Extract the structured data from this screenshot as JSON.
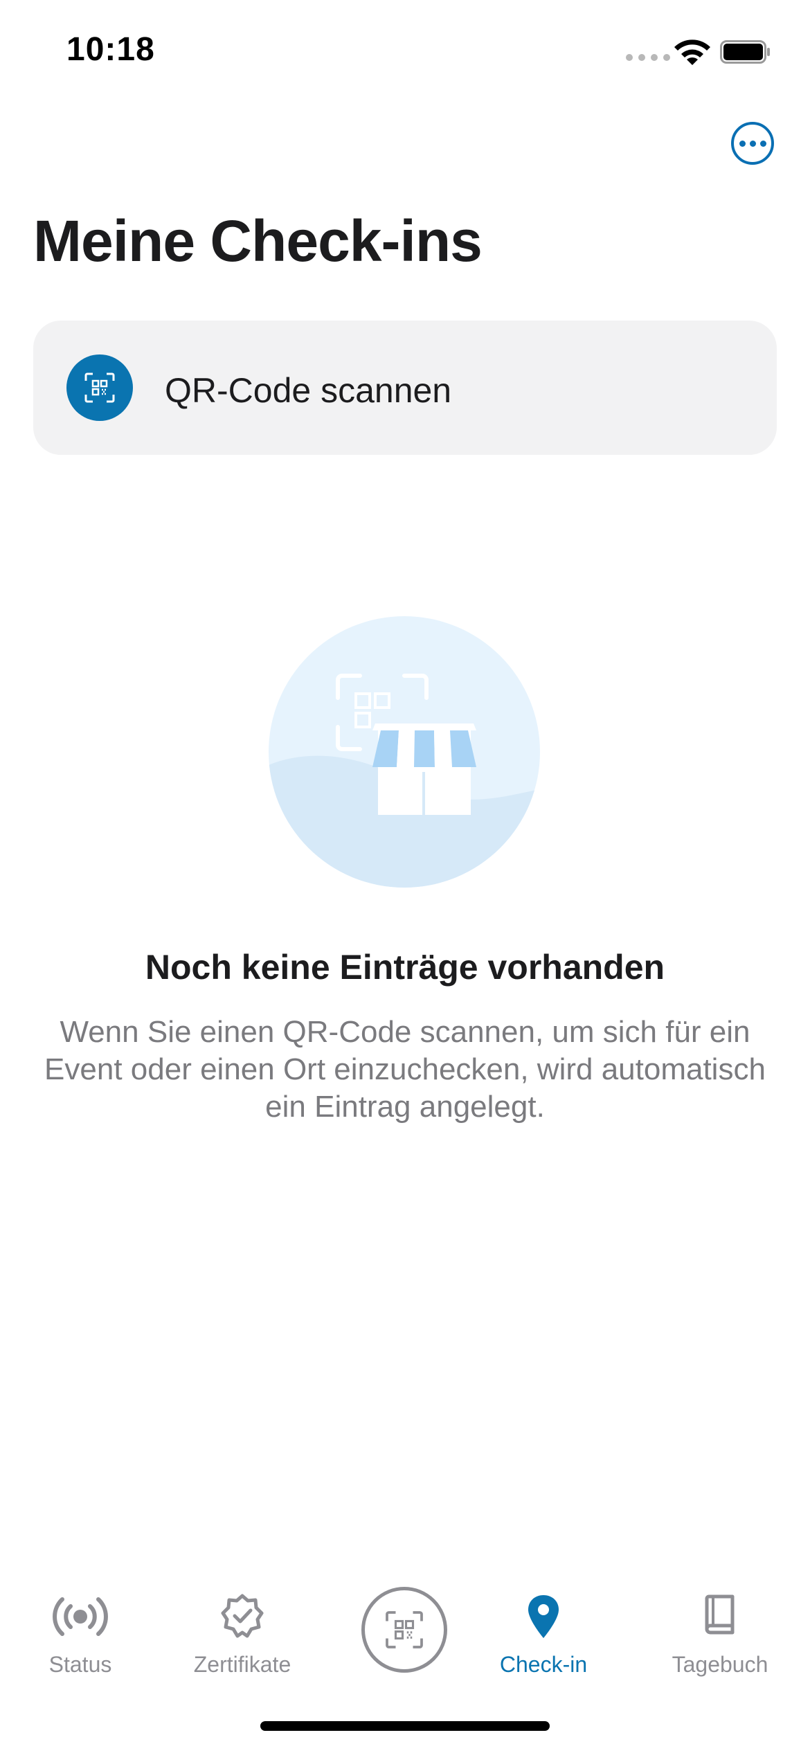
{
  "status_bar": {
    "time": "10:18"
  },
  "header": {
    "title": "Meine Check-ins"
  },
  "scan_card": {
    "label": "QR-Code scannen"
  },
  "empty_state": {
    "title": "Noch keine Einträge vorhanden",
    "description": "Wenn Sie einen QR-Code scannen, um sich für ein Event oder einen Ort einzuchecken, wird automatisch ein Eintrag angelegt."
  },
  "tab_bar": {
    "tabs": [
      {
        "label": "Status",
        "icon": "broadcast-icon"
      },
      {
        "label": "Zertifikate",
        "icon": "certificate-icon"
      },
      {
        "label": "",
        "icon": "qr-scan-icon"
      },
      {
        "label": "Check-in",
        "icon": "location-pin-icon",
        "active": true
      },
      {
        "label": "Tagebuch",
        "icon": "book-icon"
      }
    ]
  },
  "colors": {
    "accent": "#0a74b0",
    "inactive": "#8e8e93",
    "card_bg": "#f2f2f3"
  }
}
